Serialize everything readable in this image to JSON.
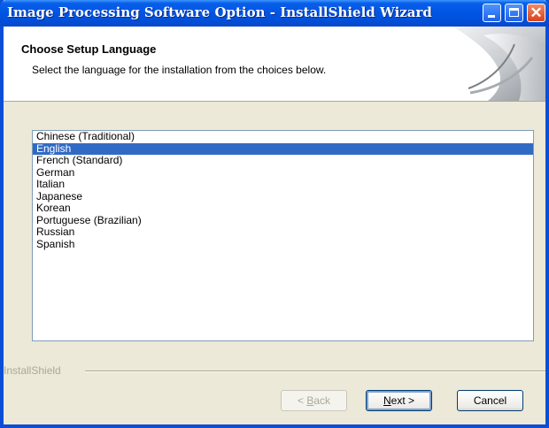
{
  "window": {
    "title": "Image Processing Software Option - InstallShield Wizard"
  },
  "header": {
    "title": "Choose Setup Language",
    "subtitle": "Select the language for the installation from the choices below."
  },
  "languages": [
    {
      "label": "Chinese (Traditional)",
      "selected": false
    },
    {
      "label": "English",
      "selected": true
    },
    {
      "label": "French (Standard)",
      "selected": false
    },
    {
      "label": "German",
      "selected": false
    },
    {
      "label": "Italian",
      "selected": false
    },
    {
      "label": "Japanese",
      "selected": false
    },
    {
      "label": "Korean",
      "selected": false
    },
    {
      "label": "Portuguese (Brazilian)",
      "selected": false
    },
    {
      "label": "Russian",
      "selected": false
    },
    {
      "label": "Spanish",
      "selected": false
    }
  ],
  "footer": {
    "brand": "InstallShield"
  },
  "buttons": {
    "back": {
      "mnemonic": "B",
      "rest": "ack",
      "prefix": "< ",
      "enabled": false
    },
    "next": {
      "mnemonic": "N",
      "rest": "ext",
      "suffix": " >",
      "enabled": true
    },
    "cancel": {
      "label": "Cancel",
      "enabled": true
    }
  },
  "colors": {
    "title_bar": "#0054e3",
    "selection": "#316ac5",
    "dialog_bg": "#ece9d8"
  }
}
